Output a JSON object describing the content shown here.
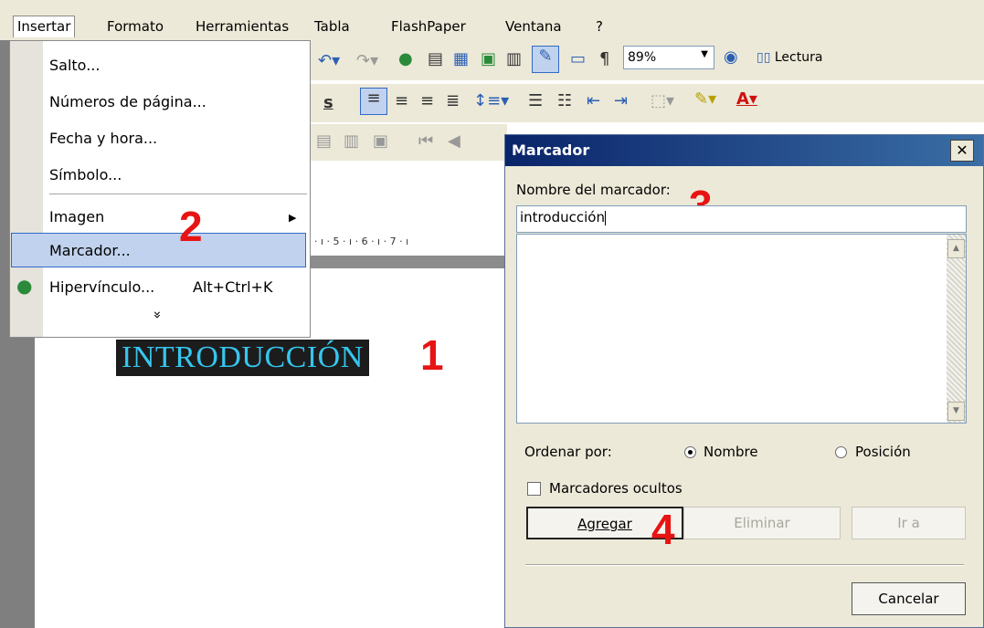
{
  "menubar": {
    "items": [
      "Insertar",
      "Formato",
      "Herramientas",
      "Tabla",
      "FlashPaper",
      "Ventana",
      "?"
    ]
  },
  "toolbar": {
    "zoom": "89%",
    "reading_label": "Lectura"
  },
  "insert_menu": {
    "items": [
      {
        "label": "Salto..."
      },
      {
        "label": "Números de página..."
      },
      {
        "label": "Fecha y hora..."
      },
      {
        "label": "Símbolo..."
      },
      {
        "label": "Imagen"
      },
      {
        "label": "Marcador..."
      },
      {
        "label": "Hipervínculo...",
        "shortcut": "Alt+Ctrl+K"
      }
    ],
    "expand_glyph": "»"
  },
  "ruler": {
    "text": "· ı · 5 · ı · 6 · ı · 7 · ı"
  },
  "document": {
    "heading": "INTRODUCCIÓN"
  },
  "steps": [
    "1",
    "2",
    "3",
    "4"
  ],
  "dialog": {
    "title": "Marcador",
    "close_glyph": "✕",
    "name_label": "Nombre del marcador:",
    "name_value": "introducción",
    "sort_label": "Ordenar por:",
    "sort_options": [
      "Nombre",
      "Posición"
    ],
    "sort_selected": "Nombre",
    "hidden_label": "Marcadores ocultos",
    "hidden_checked": false,
    "buttons": {
      "add": "Agregar",
      "delete": "Eliminar",
      "goto": "Ir a",
      "cancel": "Cancelar"
    }
  },
  "colors": {
    "title_bar": "#0a246a",
    "heading_text": "#35c6ef",
    "step_numbers": "#e81313",
    "menu_highlight": "#c1d2ee"
  }
}
